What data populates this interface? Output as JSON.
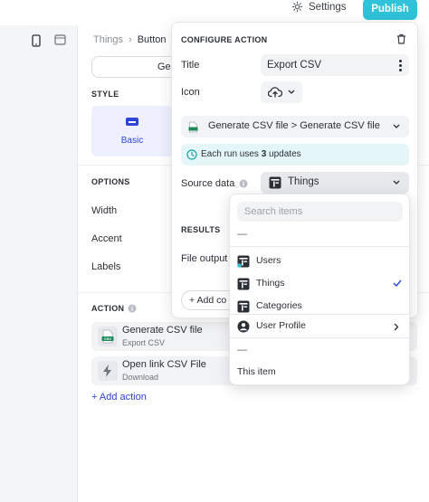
{
  "topbar": {
    "settings_label": "Settings",
    "publish_label": "Publish"
  },
  "breadcrumb": {
    "parent": "Things",
    "separator": "›",
    "current": "Button"
  },
  "component_tab_label": "Ger",
  "style": {
    "section_label": "STYLE",
    "selected_variant": "Basic"
  },
  "options": {
    "section_label": "OPTIONS",
    "rows": [
      "Width",
      "Accent",
      "Labels"
    ]
  },
  "action_section": {
    "label": "ACTION",
    "items": [
      {
        "title": "Generate CSV file",
        "subtitle": "Export CSV",
        "icon": "csv-file-icon",
        "badge": "CSV"
      },
      {
        "title": "Open link CSV File",
        "subtitle": "Download",
        "icon": "lightning-icon"
      }
    ],
    "add_label": "+ Add action"
  },
  "configure_action": {
    "header": "CONFIGURE ACTION",
    "title_label": "Title",
    "title_value": "Export CSV",
    "icon_label": "Icon",
    "icon_value": "cloud-upload-icon",
    "action_path": "Generate CSV file > Generate CSV file",
    "info_prefix": "Each run uses ",
    "info_count": "3",
    "info_suffix": " updates",
    "source_label": "Source data",
    "source_value": "Things",
    "results_label": "RESULTS",
    "file_output_label": "File output",
    "add_condition_label": "+ Add co"
  },
  "source_dropdown": {
    "search_placeholder": "Search items",
    "dash_top": "—",
    "tables": [
      {
        "label": "Users",
        "selected": false
      },
      {
        "label": "Things",
        "selected": true
      },
      {
        "label": "Categories",
        "selected": false
      }
    ],
    "user_profile_label": "User Profile",
    "dash_bottom": "—",
    "this_item_label": "This item"
  },
  "colors": {
    "accent": "#2f44d9",
    "publish": "#2fc2d8",
    "info_bg": "#e4f6f8",
    "info_icon": "#1ba7a0"
  }
}
